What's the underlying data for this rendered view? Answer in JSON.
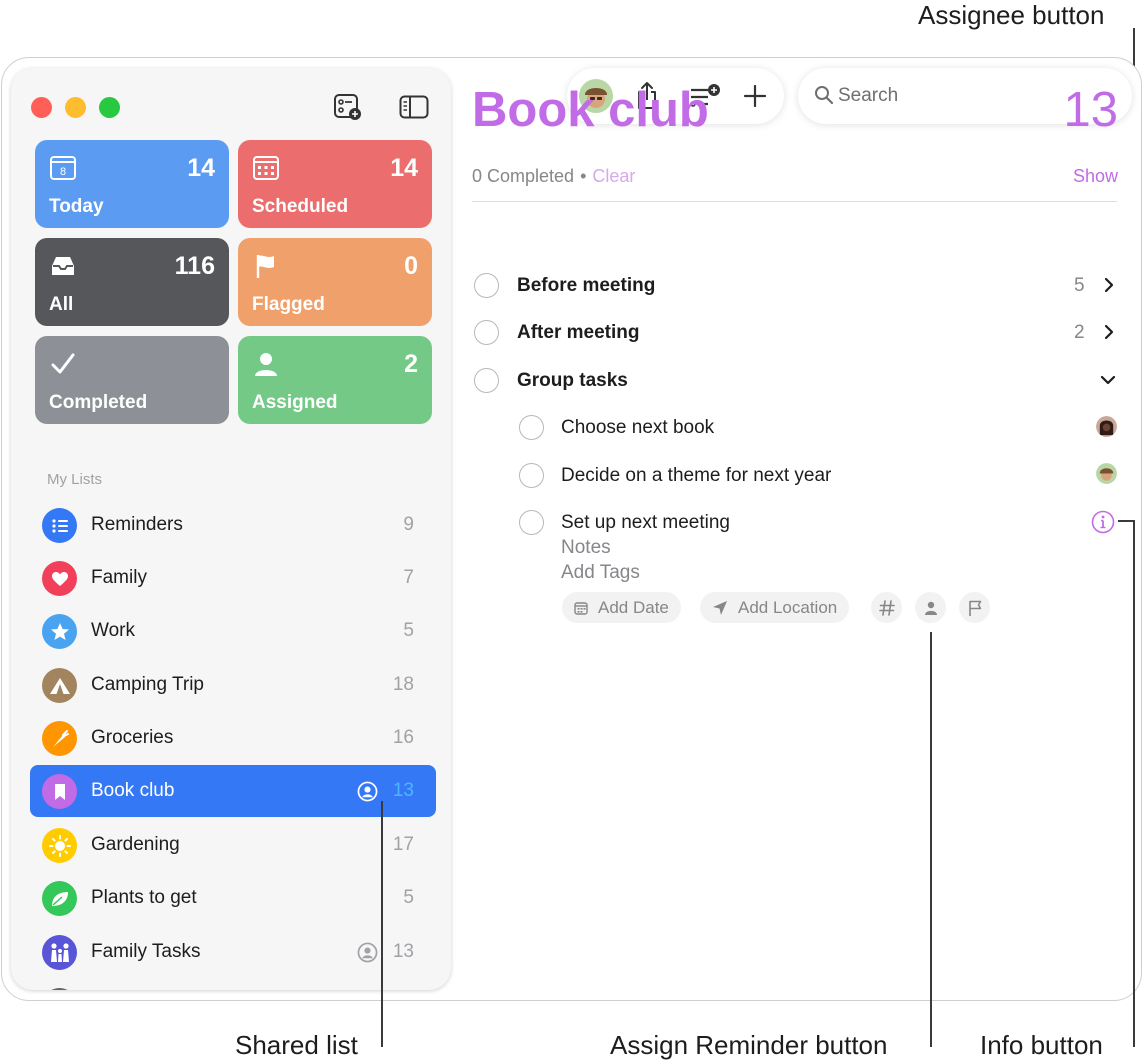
{
  "callouts": {
    "assignee": "Assignee button",
    "shared_list": "Shared list",
    "assign_reminder": "Assign Reminder button",
    "info": "Info button"
  },
  "smart_lists": [
    {
      "label": "Today",
      "count": "14",
      "color": "#5b9cf2",
      "icon": "calendar-today-icon",
      "icon_text": "8"
    },
    {
      "label": "Scheduled",
      "count": "14",
      "color": "#ec6d6d",
      "icon": "calendar-grid-icon"
    },
    {
      "label": "All",
      "count": "116",
      "color": "#55575a",
      "icon": "tray-icon"
    },
    {
      "label": "Flagged",
      "count": "0",
      "color": "#f0a06a",
      "icon": "flag-icon"
    },
    {
      "label": "Completed",
      "count": "",
      "color": "#8d9197",
      "icon": "checkmark-icon"
    },
    {
      "label": "Assigned",
      "count": "2",
      "color": "#74c987",
      "icon": "person-icon"
    }
  ],
  "sidebar": {
    "section_title": "My Lists",
    "lists": [
      {
        "name": "Reminders",
        "count": "9",
        "color": "#3478f6",
        "icon": "list-bullet-icon"
      },
      {
        "name": "Family",
        "count": "7",
        "color": "#f2405b",
        "icon": "heart-icon"
      },
      {
        "name": "Work",
        "count": "5",
        "color": "#4aa3f0",
        "icon": "star-icon"
      },
      {
        "name": "Camping Trip",
        "count": "18",
        "color": "#a2845e",
        "icon": "tent-icon"
      },
      {
        "name": "Groceries",
        "count": "16",
        "color": "#ff9500",
        "icon": "carrot-icon"
      },
      {
        "name": "Book club",
        "count": "13",
        "color": "#c26be6",
        "icon": "bookmark-icon",
        "selected": true,
        "shared": true
      },
      {
        "name": "Gardening",
        "count": "17",
        "color": "#ffcc00",
        "icon": "sun-icon"
      },
      {
        "name": "Plants to get",
        "count": "5",
        "color": "#34c759",
        "icon": "leaf-icon"
      },
      {
        "name": "Family Tasks",
        "count": "13",
        "color": "#5856d6",
        "icon": "family-icon",
        "shared": true
      }
    ]
  },
  "search": {
    "placeholder": "Search"
  },
  "main": {
    "title": "Book club",
    "count": "13",
    "completed_text": "0 Completed",
    "dot": "•",
    "clear_label": "Clear",
    "show_label": "Show",
    "tasks": [
      {
        "name": "Before meeting",
        "count": "5"
      },
      {
        "name": "After meeting",
        "count": "2"
      },
      {
        "name": "Group tasks"
      }
    ],
    "subtasks": [
      {
        "name": "Choose next book"
      },
      {
        "name": "Decide on a theme for next year"
      },
      {
        "name": "Set up next meeting"
      }
    ],
    "notes_placeholder": "Notes",
    "tags_placeholder": "Add Tags",
    "add_date_label": "Add Date",
    "add_location_label": "Add Location"
  }
}
